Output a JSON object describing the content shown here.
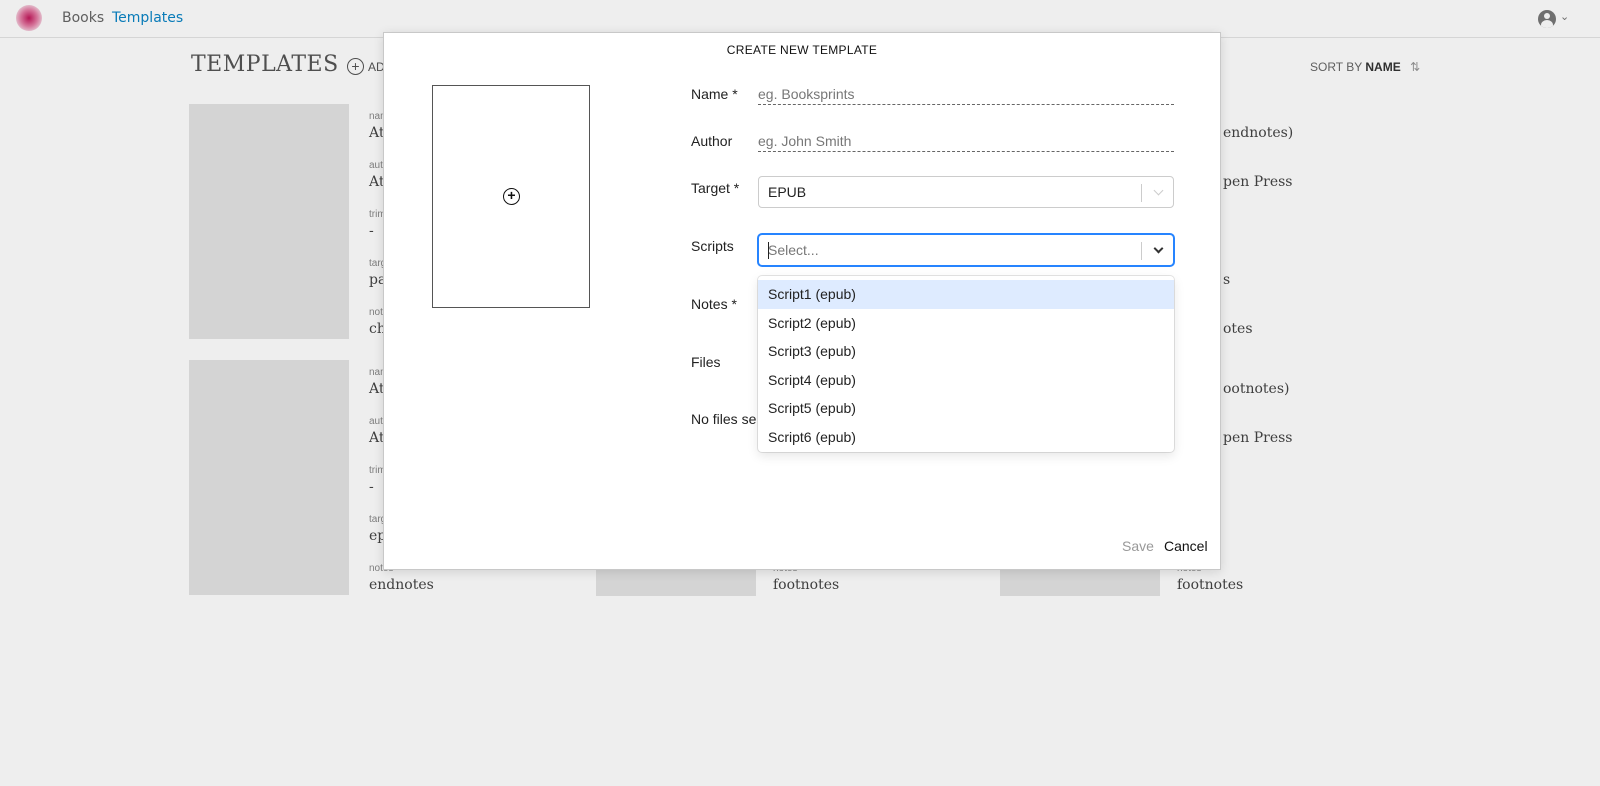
{
  "nav": {
    "books": "Books",
    "templates": "Templates"
  },
  "page": {
    "title": "TEMPLATES",
    "add_label": "ADD",
    "sort_label": "SORT BY",
    "sort_field": "NAME"
  },
  "cards": [
    {
      "fields": [
        {
          "label": "name",
          "value": "At"
        },
        {
          "label": "author",
          "value": "At"
        },
        {
          "label": "trim",
          "value": "-"
        },
        {
          "label": "target",
          "value": "pa"
        },
        {
          "label": "notes",
          "value": "ch"
        }
      ]
    },
    {
      "fields": [
        {
          "label": "name",
          "value": "At"
        },
        {
          "label": "author",
          "value": "At"
        },
        {
          "label": "trim",
          "value": "-"
        },
        {
          "label": "target",
          "value": "ep"
        },
        {
          "label": "notes",
          "value": "endnotes"
        }
      ]
    },
    {
      "fields": [
        {
          "label": "notes",
          "value": "footnotes"
        }
      ]
    },
    {
      "fields": [
        {
          "value": "endnotes)"
        },
        {
          "value": "pen Press"
        },
        {
          "value": "s"
        },
        {
          "value": "otes"
        }
      ]
    },
    {
      "fields": [
        {
          "value": "ootnotes)"
        },
        {
          "value": "pen Press"
        },
        {
          "label": "notes",
          "value": "footnotes"
        }
      ]
    }
  ],
  "modal": {
    "title": "CREATE NEW TEMPLATE",
    "name_label": "Name *",
    "name_placeholder": "eg. Booksprints",
    "author_label": "Author",
    "author_placeholder": "eg. John Smith",
    "target_label": "Target *",
    "target_value": "EPUB",
    "scripts_label": "Scripts",
    "scripts_placeholder": "Select...",
    "notes_label": "Notes *",
    "files_label": "Files",
    "files_status": "No files sel",
    "scripts_options": [
      "Script1 (epub)",
      "Script2 (epub)",
      "Script3 (epub)",
      "Script4 (epub)",
      "Script5 (epub)",
      "Script6 (epub)"
    ],
    "save_label": "Save",
    "cancel_label": "Cancel"
  },
  "colors": {
    "accent": "#0a84c6",
    "focus": "#2684ff",
    "option_highlight": "#deebff"
  }
}
